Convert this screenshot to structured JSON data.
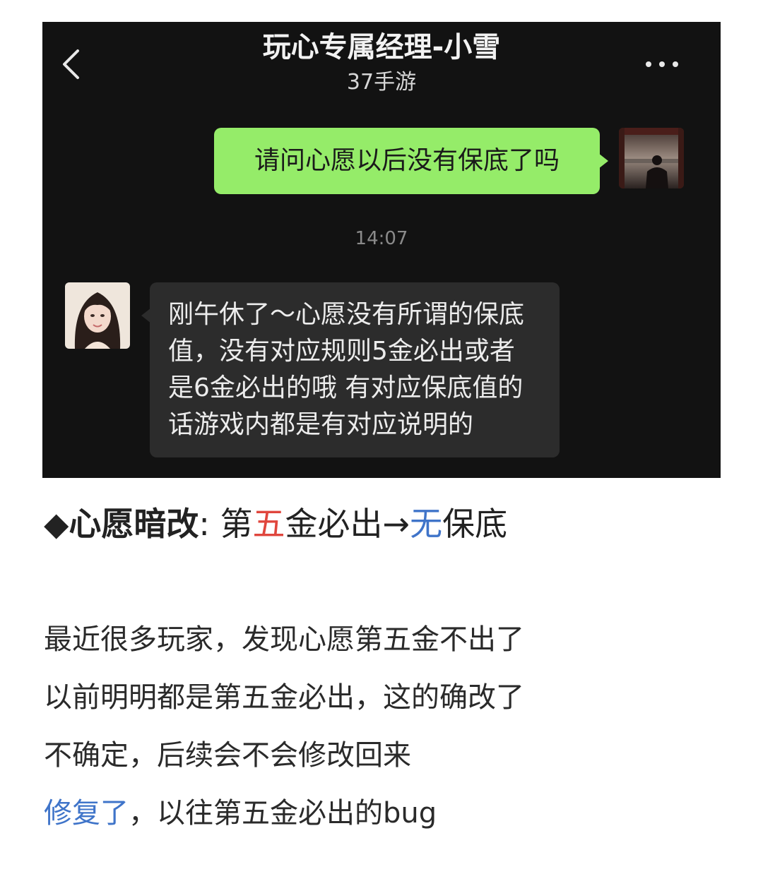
{
  "chat": {
    "title": "玩心专属经理-小雪",
    "subtitle": "37手游",
    "timestamp": "14:07",
    "outgoing_message": "请问心愿以后没有保底了吗",
    "incoming_message_lines": [
      "刚午休了～心愿没有所谓的保底",
      "值，没有对应规则5金必出或者",
      "是6金必出的哦 有对应保底值的",
      "话游戏内都是有对应说明的"
    ],
    "icons": {
      "back": "chevron-left-icon",
      "more": "more-dots-icon"
    },
    "colors": {
      "outgoing_bubble": "#95ec69",
      "incoming_bubble": "#2c2c2c",
      "background": "#121212"
    }
  },
  "article": {
    "heading": {
      "bullet": "◆",
      "bold": "心愿暗改",
      "colon": ":",
      "part1": "第",
      "highlight_red": "五",
      "part2": "金必出→",
      "highlight_blue": "无",
      "part3": "保底"
    },
    "lines": [
      "最近很多玩家，发现心愿第五金不出了",
      "以前明明都是第五金必出，这的确改了",
      "不确定，后续会不会修改回来"
    ],
    "last_line": {
      "highlight_blue": "修复了",
      "rest": "，以往第五金必出的bug"
    },
    "colors": {
      "red": "#e0463d",
      "blue": "#3f74c9"
    }
  }
}
